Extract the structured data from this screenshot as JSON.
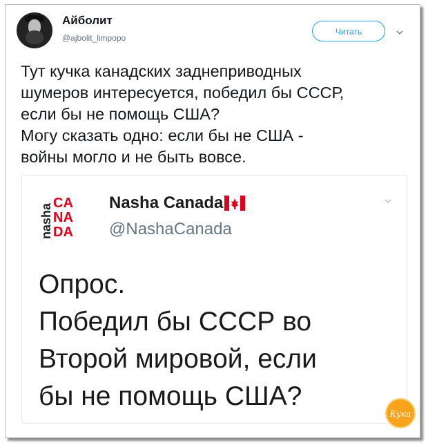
{
  "author": {
    "name": "Айболит",
    "handle": "@ajbolit_limpopo"
  },
  "follow_button": {
    "label": "Читать"
  },
  "tweet_lines": [
    "Тут кучка канадских заднеприводных",
    "шумеров интересуется, победил бы СССР,",
    "если бы не помощь США?",
    "Могу сказать одно: если бы не США -",
    "войны могло и не быть вовсе."
  ],
  "quoted": {
    "name": "Nasha Canada",
    "handle": "@NashaCanada",
    "logo_text": "nasha CA NA DA",
    "lines": [
      "Опрос.",
      "Победил бы СССР во",
      "Второй мировой, если",
      "бы не помощь США?"
    ]
  },
  "watermark": {
    "text": "Кука"
  },
  "colors": {
    "accent": "#1da1f2",
    "text": "#14171a",
    "muted": "#657786",
    "logo_red": "#e0001b",
    "badge_orange": "#f7a31c"
  },
  "icons": [
    "chevron-down-icon",
    "canada-flag-icon",
    "nasha-canada-logo",
    "watermark-badge-icon"
  ]
}
